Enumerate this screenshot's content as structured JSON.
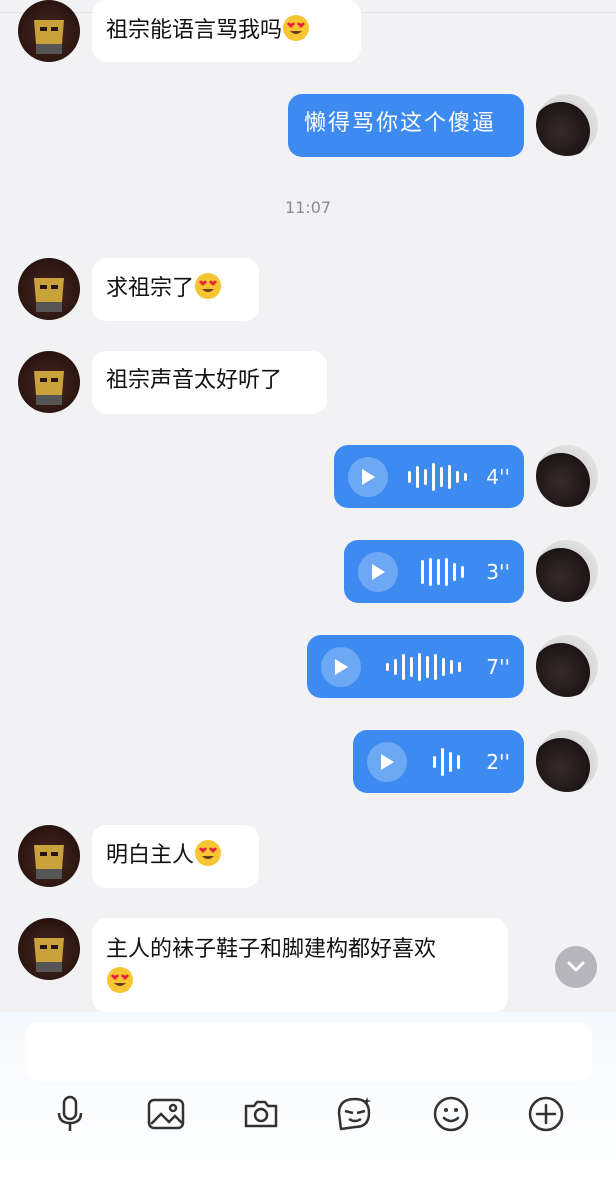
{
  "messages": {
    "m1": "祖宗能语言骂我吗",
    "m2": "懒得骂你这个傻逼",
    "timestamp": "11:07",
    "m3": "求祖宗了",
    "m4": "祖宗声音太好听了",
    "voice1": "4''",
    "voice2": "3''",
    "voice3": "7''",
    "voice4": "2''",
    "m5": "明白主人",
    "m6": "主人的袜子鞋子和脚建构都好喜欢"
  },
  "colors": {
    "background": "#f2f2f4",
    "bubble_in": "#ffffff",
    "bubble_out": "#3d8bf0",
    "icon": "#333333"
  },
  "toolbar": {
    "icons": [
      "microphone-icon",
      "image-icon",
      "camera-icon",
      "sticker-icon",
      "emoji-icon",
      "plus-icon"
    ]
  }
}
